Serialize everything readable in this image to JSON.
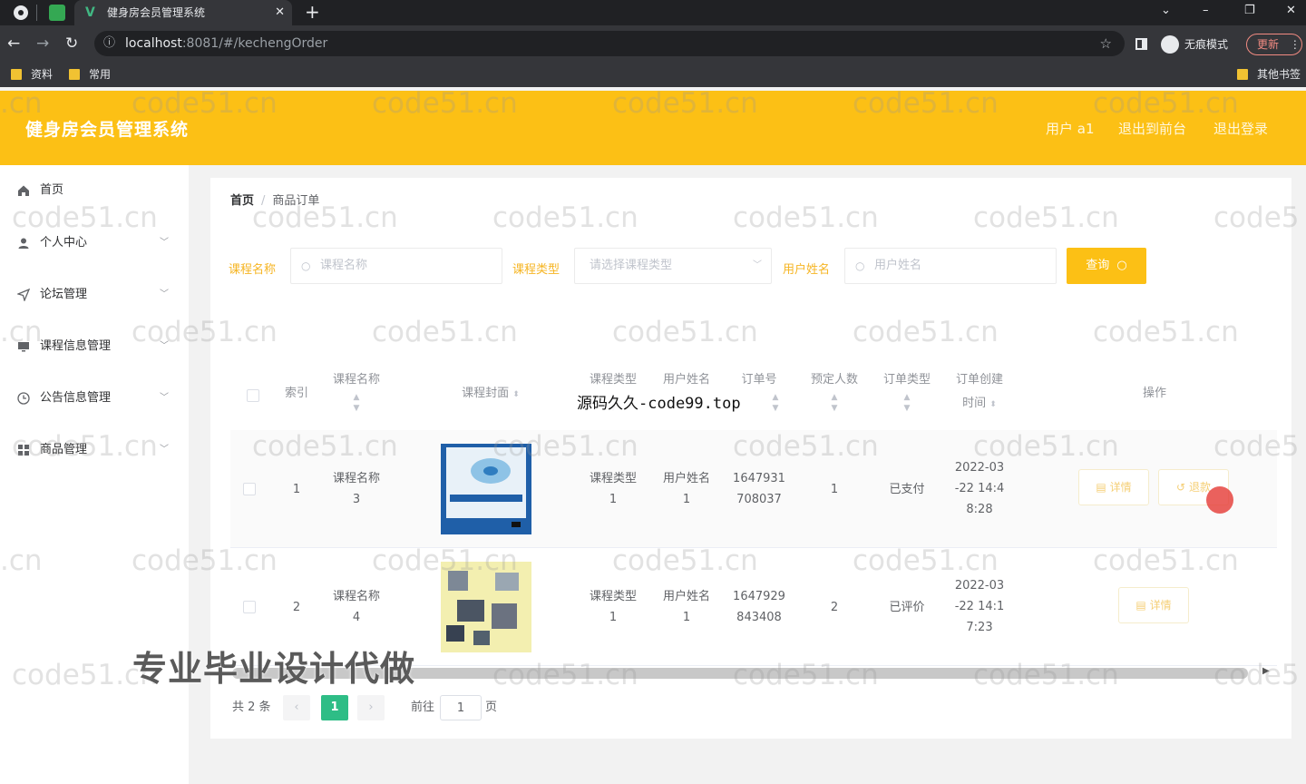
{
  "browser": {
    "tab_title": "健身房会员管理系统",
    "url_host": "localhost",
    "url_path": ":8081/#/kechengOrder",
    "incognito_label": "无痕模式",
    "update_label": "更新",
    "bookmarks": [
      "资料",
      "常用"
    ],
    "other_bookmarks": "其他书签"
  },
  "app": {
    "title": "健身房会员管理系统",
    "user": "用户 a1",
    "back_frontend": "退出到前台",
    "logout": "退出登录",
    "accent": "#fcc015"
  },
  "sidebar": {
    "items": [
      {
        "label": "首页"
      },
      {
        "label": "个人中心"
      },
      {
        "label": "论坛管理"
      },
      {
        "label": "课程信息管理"
      },
      {
        "label": "公告信息管理"
      },
      {
        "label": "商品管理"
      }
    ]
  },
  "breadcrumb": {
    "home": "首页",
    "current": "商品订单"
  },
  "filters": {
    "course_name_label": "课程名称",
    "course_name_placeholder": "课程名称",
    "course_type_label": "课程类型",
    "course_type_placeholder": "请选择课程类型",
    "user_name_label": "用户姓名",
    "user_name_placeholder": "用户姓名",
    "query_label": "查询"
  },
  "table": {
    "headers": {
      "index": "索引",
      "course_name": "课程名称",
      "cover": "课程封面",
      "course_type": "课程类型",
      "user_name": "用户姓名",
      "order_no": "订单号",
      "count": "预定人数",
      "order_type": "订单类型",
      "created_1": "订单创建",
      "created_2": "时间",
      "ops": "操作"
    },
    "rows": [
      {
        "index": "1",
        "name_1": "课程名称",
        "name_2": "3",
        "type_1": "课程类型",
        "type_2": "1",
        "user_1": "用户姓名",
        "user_2": "1",
        "no_1": "1647931",
        "no_2": "708037",
        "count": "1",
        "status": "已支付",
        "t1": "2022-03",
        "t2": "-22 14:4",
        "t3": "8:28",
        "btn_detail": "详情",
        "btn_refund": "退款"
      },
      {
        "index": "2",
        "name_1": "课程名称",
        "name_2": "4",
        "type_1": "课程类型",
        "type_2": "1",
        "user_1": "用户姓名",
        "user_2": "1",
        "no_1": "1647929",
        "no_2": "843408",
        "count": "2",
        "status": "已评价",
        "t1": "2022-03",
        "t2": "-22 14:1",
        "t3": "7:23",
        "btn_detail": "详情"
      }
    ]
  },
  "pagination": {
    "total": "共 2 条",
    "prev": "‹",
    "current": "1",
    "next": "›",
    "goto": "前往",
    "page_value": "1",
    "page_unit": "页"
  },
  "overlays": {
    "watermark": "code51.cn",
    "watermark_cut_left": ".cn",
    "watermark_cut_right": "code5",
    "banner": "源码久久-code99.top",
    "promo": "专业毕业设计代做"
  },
  "icons": {
    "home": "home-icon",
    "user": "user-icon",
    "forum": "send-icon",
    "course": "monitor-icon",
    "notice": "clock-icon",
    "goods": "grid-icon",
    "search": "search-icon",
    "detail": "document-icon",
    "refund": "refresh-icon"
  }
}
